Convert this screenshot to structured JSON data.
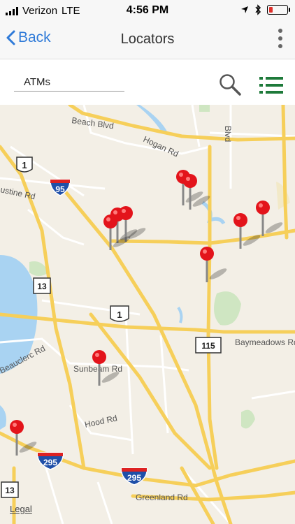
{
  "status_bar": {
    "carrier": "Verizon",
    "network": "LTE",
    "time": "4:56 PM"
  },
  "nav": {
    "back_label": "Back",
    "title": "Locators"
  },
  "search": {
    "value": "ATMs"
  },
  "map": {
    "road_labels": {
      "beach": "Beach Blvd",
      "hogan": "Hogan Rd",
      "blvd": "Blvd",
      "augustine": "ustine Rd",
      "beauclerc": "Beauclerc Rd",
      "sunbeam": "Sunbeam Rd",
      "baymeadows": "Baymeadows Rd",
      "hood": "Hood Rd",
      "greenland": "Greenland Rd"
    },
    "shields": {
      "us1_top": "1",
      "i95": "95",
      "sr13_mid": "13",
      "us1_mid": "1",
      "sr115": "115",
      "i295_left": "295",
      "i295_right": "295",
      "sr13_bottom": "13"
    },
    "legal_label": "Legal",
    "pin_count": 11
  },
  "colors": {
    "accent": "#2f7ad8",
    "list_icon": "#1e7a3a",
    "pin": "#e3141b",
    "road": "#f6cf5a"
  }
}
